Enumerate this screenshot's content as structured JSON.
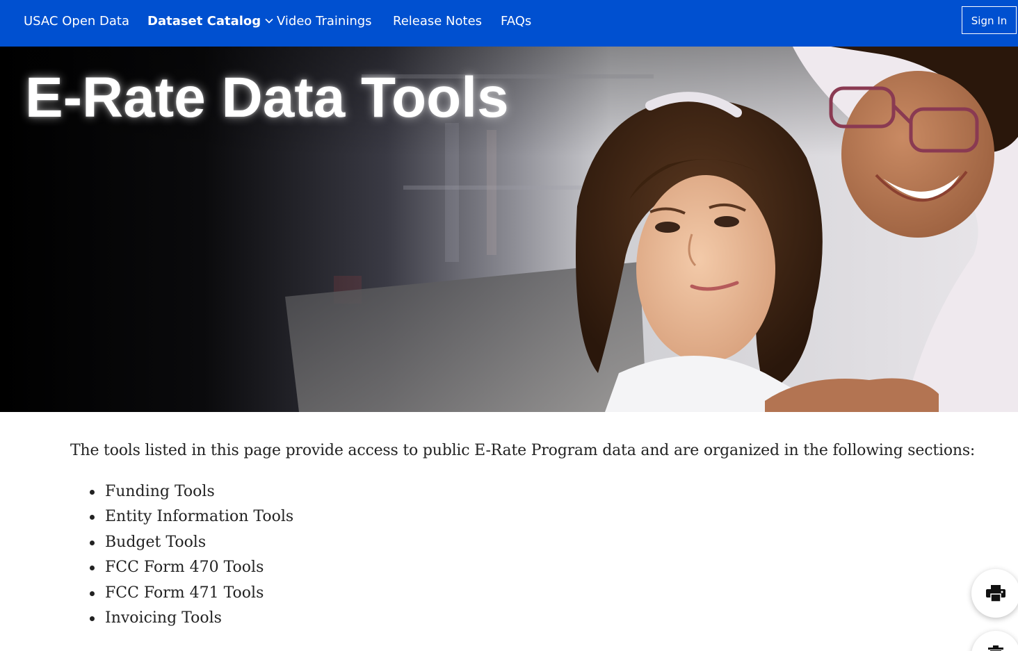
{
  "nav": {
    "home": "USAC Open Data",
    "catalog": "Dataset Catalog",
    "videos": "Video Trainings",
    "release": "Release Notes",
    "faqs": "FAQs",
    "signin": "Sign In"
  },
  "hero": {
    "title": "E-Rate Data Tools"
  },
  "content": {
    "intro": "The tools listed in this page provide access to public E-Rate Program data and are organized in the following sections:",
    "sections": [
      "Funding Tools",
      "Entity Information Tools",
      "Budget Tools",
      "FCC Form 470 Tools",
      "FCC Form 471 Tools",
      "Invoicing Tools"
    ]
  },
  "icons": {
    "catalog_caret": "chevron-down-icon",
    "print": "printer-icon",
    "second_fab": "trash-icon"
  },
  "colors": {
    "nav_background": "#0050d0",
    "text": "#222222"
  }
}
